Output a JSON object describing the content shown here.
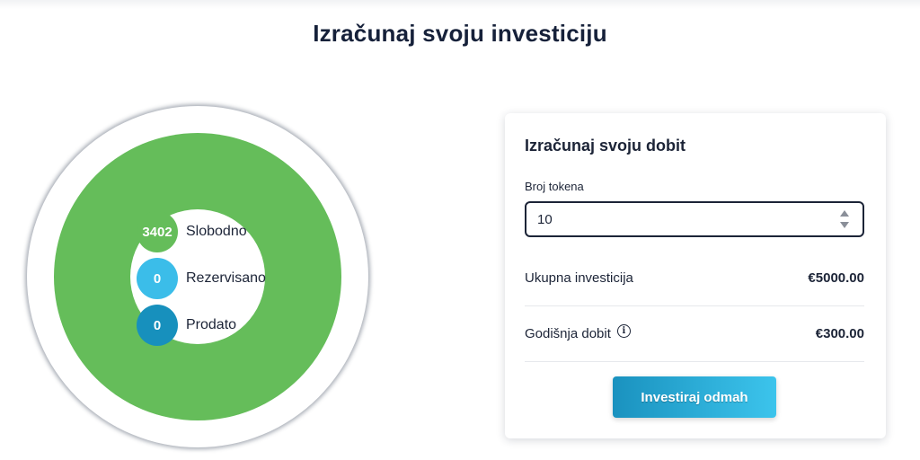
{
  "page": {
    "title": "Izračunaj svoju investiciju"
  },
  "status_chart": {
    "ring_color": "#65bd5a",
    "legend": [
      {
        "value": "3402",
        "label": "Slobodno",
        "color": "#65bd5a"
      },
      {
        "value": "0",
        "label": "Rezervisano",
        "color": "#3bbde9"
      },
      {
        "value": "0",
        "label": "Prodato",
        "color": "#1790bd"
      }
    ]
  },
  "calculator": {
    "title": "Izračunaj svoju dobit",
    "token_label": "Broj tokena",
    "token_value": "10",
    "stepper_icon": "stepper-arrows-icon",
    "total_label": "Ukupna investicija",
    "total_value": "€5000.00",
    "annual_label": "Godišnja dobit",
    "annual_info_icon": "info-icon",
    "annual_value": "€300.00",
    "invest_button_label": "Investiraj odmah",
    "accent_color": "#1a92bf"
  }
}
